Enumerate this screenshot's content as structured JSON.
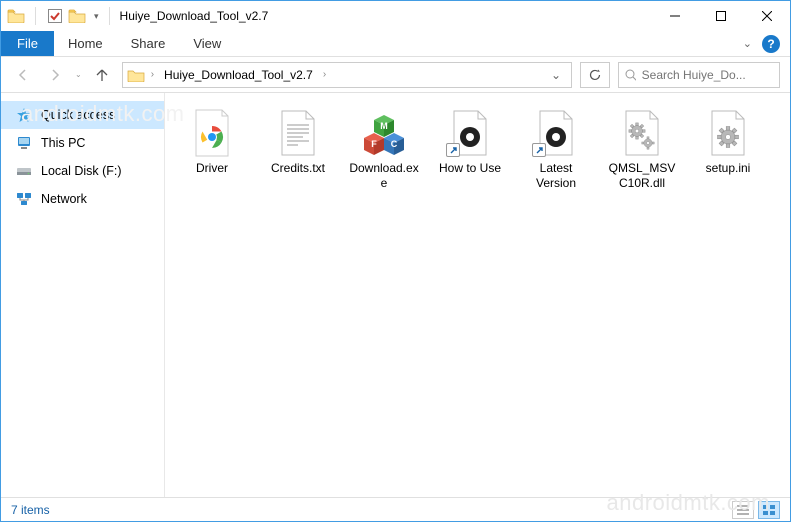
{
  "window": {
    "title": "Huiye_Download_Tool_v2.7"
  },
  "ribbon": {
    "file_label": "File",
    "tabs": [
      "Home",
      "Share",
      "View"
    ]
  },
  "address": {
    "folder_name": "Huiye_Download_Tool_v2.7"
  },
  "search": {
    "placeholder": "Search Huiye_Do..."
  },
  "sidebar": {
    "items": [
      {
        "label": "Quick access"
      },
      {
        "label": "This PC"
      },
      {
        "label": "Local Disk (F:)"
      },
      {
        "label": "Network"
      }
    ]
  },
  "files": [
    {
      "label": "Driver",
      "icon": "chrome"
    },
    {
      "label": "Credits.txt",
      "icon": "text"
    },
    {
      "label": "Download.exe",
      "icon": "cubes"
    },
    {
      "label": "How to Use",
      "icon": "ring-shortcut"
    },
    {
      "label": "Latest Version",
      "icon": "ring-shortcut"
    },
    {
      "label": "QMSL_MSVC10R.dll",
      "icon": "gears"
    },
    {
      "label": "setup.ini",
      "icon": "gear"
    }
  ],
  "status": {
    "text": "7 items"
  },
  "watermark": "androidmtk.com"
}
